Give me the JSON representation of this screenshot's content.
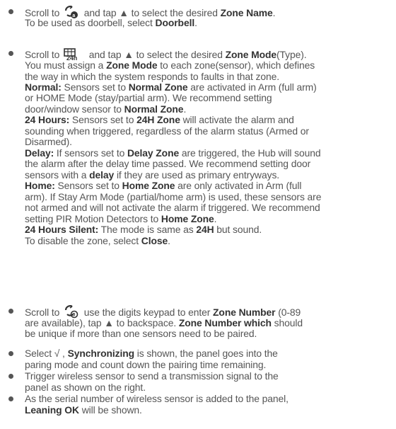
{
  "items": [
    {
      "lines": [
        {
          "parts": [
            [
              "Scroll to ",
              false
            ],
            [
              "ICON:zone-name",
              false
            ],
            [
              " and tap ▲ to select the desired ",
              false
            ],
            [
              "Zone Name",
              true
            ],
            [
              ".",
              false
            ]
          ]
        },
        {
          "parts": [
            [
              "To be used as doorbell, select ",
              false
            ],
            [
              "Doorbell",
              true
            ],
            [
              ".",
              false
            ]
          ]
        }
      ]
    },
    {
      "lines": [
        {
          "parts": [
            [
              "Scroll to ",
              false
            ],
            [
              "ICON:zone-mode-24h",
              false
            ],
            [
              " and tap ▲ to select the desired ",
              false
            ],
            [
              "Zone Mode",
              true
            ],
            [
              "(Type).",
              false
            ]
          ]
        },
        {
          "parts": [
            [
              "You must assign a ",
              false
            ],
            [
              "Zone Mode",
              true
            ],
            [
              " to each zone(sensor), which defines",
              false
            ]
          ]
        },
        {
          "parts": [
            [
              "the way in which the system responds to faults in that zone.",
              false
            ]
          ]
        },
        {
          "parts": [
            [
              "Normal:",
              true
            ],
            [
              " Sensors set to ",
              false
            ],
            [
              "Normal Zone",
              true
            ],
            [
              " are activated in Arm (full arm)",
              false
            ]
          ]
        },
        {
          "parts": [
            [
              "or HOME Mode (stay/partial arm). We recommend setting",
              false
            ]
          ]
        },
        {
          "parts": [
            [
              "door/window sensor to ",
              false
            ],
            [
              "Normal Zone",
              true
            ],
            [
              ".",
              false
            ]
          ]
        },
        {
          "parts": [
            [
              "24 Hours:",
              true
            ],
            [
              " Sensors set to ",
              false
            ],
            [
              "24H Zone",
              true
            ],
            [
              " will activate the alarm and",
              false
            ]
          ]
        },
        {
          "parts": [
            [
              "sounding when triggered, regardless of the alarm status (Armed or",
              false
            ]
          ]
        },
        {
          "parts": [
            [
              "Disarmed).",
              false
            ]
          ]
        },
        {
          "parts": [
            [
              "Delay:",
              true
            ],
            [
              " If sensors set to ",
              false
            ],
            [
              "Delay Zone",
              true
            ],
            [
              " are triggered, the Hub will sound",
              false
            ]
          ]
        },
        {
          "parts": [
            [
              "the alarm after the delay time passed. We recommend setting door",
              false
            ]
          ]
        },
        {
          "parts": [
            [
              "sensors with a ",
              false
            ],
            [
              "delay",
              true
            ],
            [
              " if they are used as primary entryways.",
              false
            ]
          ]
        },
        {
          "parts": [
            [
              "Home:",
              true
            ],
            [
              " Sensors set to ",
              false
            ],
            [
              "Home Zone",
              true
            ],
            [
              " are only activated in Arm (full",
              false
            ]
          ]
        },
        {
          "parts": [
            [
              "arm). If Stay Arm Mode (partial/home arm) is used, these sensors are",
              false
            ]
          ]
        },
        {
          "parts": [
            [
              "not armed and will not activate the alarm if triggered. We recommend",
              false
            ]
          ]
        },
        {
          "parts": [
            [
              "setting PIR Motion Detectors to ",
              false
            ],
            [
              "Home Zone",
              true
            ],
            [
              ".",
              false
            ]
          ]
        },
        {
          "parts": [
            [
              "24 Hours Silent:",
              true
            ],
            [
              " The mode is same as ",
              false
            ],
            [
              "24H",
              true
            ],
            [
              " but sound.",
              false
            ]
          ]
        },
        {
          "parts": [
            [
              "To disable the zone, select ",
              false
            ],
            [
              "Close",
              true
            ],
            [
              ".",
              false
            ]
          ]
        }
      ]
    },
    {
      "lines": [
        {
          "parts": [
            [
              "Scroll to ",
              false
            ],
            [
              "ICON:zone-number",
              false
            ],
            [
              " use the digits keypad to enter ",
              false
            ],
            [
              "Zone Number",
              true
            ],
            [
              " (0-89",
              false
            ]
          ]
        },
        {
          "parts": [
            [
              "are available), tap ▲ to backspace. ",
              false
            ],
            [
              "Zone Number which",
              true
            ],
            [
              " should",
              false
            ]
          ]
        },
        {
          "parts": [
            [
              "be unique if more than one sensors need to be paired.",
              false
            ]
          ]
        }
      ]
    },
    {
      "lines": [
        {
          "parts": [
            [
              "Select √ , ",
              false
            ],
            [
              "Synchronizing",
              true
            ],
            [
              " is shown, the panel goes into the",
              false
            ]
          ]
        },
        {
          "parts": [
            [
              "paring mode and count down the pairing time remaining.",
              false
            ]
          ]
        }
      ]
    },
    {
      "lines": [
        {
          "parts": [
            [
              "Trigger wireless sensor to send a transmission signal to the",
              false
            ]
          ]
        },
        {
          "parts": [
            [
              "panel as shown on the right.",
              false
            ]
          ]
        }
      ]
    },
    {
      "lines": [
        {
          "parts": [
            [
              "As the serial number of wireless sensor is added to the panel,",
              false
            ]
          ]
        },
        {
          "parts": [
            [
              "Leaning OK",
              true
            ],
            [
              " will be shown.",
              false
            ]
          ]
        }
      ]
    }
  ],
  "icons": {
    "zone-name": "gear-a-icon",
    "zone-mode-24h": "box-24h-icon",
    "zone-number": "gear-circle-icon"
  },
  "colors": {
    "text": "#555555",
    "bold": "#333333"
  }
}
